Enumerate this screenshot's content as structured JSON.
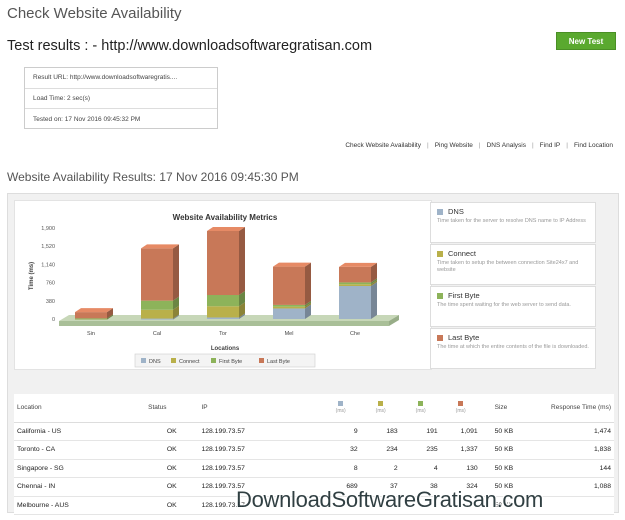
{
  "page": {
    "title": "Check Website Availability"
  },
  "test": {
    "header": "Test results : - http://www.downloadsoftwaregratisan.com",
    "new_test_label": "New Test",
    "result_url": "Result URL: http://www.downloadsoftwaregratis....",
    "load_time": "Load Time: 2 sec(s)",
    "tested_on": "Tested on: 17 Nov 2016 09:45:32 PM"
  },
  "tools": [
    "Check Website Availability",
    "Ping Website",
    "DNS Analysis",
    "Find IP",
    "Find Location"
  ],
  "results_title": "Website Availability Results: 17 Nov 2016 09:45:30 PM",
  "colors": {
    "dns": "#9fb3c8",
    "connect": "#b9b04a",
    "first_byte": "#8db35a",
    "last_byte": "#c87858",
    "accent": "#5aa92f"
  },
  "chart_data": {
    "type": "bar",
    "stacked": true,
    "title": "Website Availability Metrics",
    "xlabel": "Locations",
    "ylabel": "Time (ms)",
    "ylim": [
      0,
      1900
    ],
    "yticks": [
      "0",
      "380",
      "760",
      "1,140",
      "1,520",
      "1,900"
    ],
    "ytick_values": [
      0,
      380,
      760,
      1140,
      1520,
      1900
    ],
    "categories": [
      "Sin",
      "Cal",
      "Tor",
      "Mel",
      "Che"
    ],
    "series": [
      {
        "name": "DNS",
        "values": [
          8,
          9,
          32,
          220,
          689
        ]
      },
      {
        "name": "Connect",
        "values": [
          2,
          183,
          234,
          37,
          37
        ]
      },
      {
        "name": "First Byte",
        "values": [
          4,
          191,
          235,
          37,
          38
        ]
      },
      {
        "name": "Last Byte",
        "values": [
          130,
          1091,
          1337,
          800,
          324
        ]
      }
    ],
    "legend_position": "bottom",
    "grid": false
  },
  "metrics_legend": [
    {
      "title": "DNS",
      "desc": "Time taken for the server to resolve DNS name to IP Address"
    },
    {
      "title": "Connect",
      "desc": "Time taken to setup the between connection Site24x7 and website"
    },
    {
      "title": "First Byte",
      "desc": "The time spent waiting for the web server to send data."
    },
    {
      "title": "Last Byte",
      "desc": "The time at which the entire contents of the file is downloaded."
    }
  ],
  "table": {
    "headers": {
      "location": "Location",
      "status": "Status",
      "ip": "IP",
      "ms": "(ms)",
      "size": "Size",
      "response": "Response Time (ms)"
    },
    "rows": [
      {
        "location": "California - US",
        "status": "OK",
        "ip": "128.199.73.57",
        "dns": "9",
        "connect": "183",
        "first": "191",
        "last": "1,091",
        "size": "50 KB",
        "resp": "1,474"
      },
      {
        "location": "Toronto - CA",
        "status": "OK",
        "ip": "128.199.73.57",
        "dns": "32",
        "connect": "234",
        "first": "235",
        "last": "1,337",
        "size": "50 KB",
        "resp": "1,838"
      },
      {
        "location": "Singapore - SG",
        "status": "OK",
        "ip": "128.199.73.57",
        "dns": "8",
        "connect": "2",
        "first": "4",
        "last": "130",
        "size": "50 KB",
        "resp": "144"
      },
      {
        "location": "Chennai - IN",
        "status": "OK",
        "ip": "128.199.73.57",
        "dns": "689",
        "connect": "37",
        "first": "38",
        "last": "324",
        "size": "50 KB",
        "resp": "1,088"
      },
      {
        "location": "Melbourne - AUS",
        "status": "OK",
        "ip": "128.199.73.57",
        "dns": "",
        "connect": "",
        "first": "",
        "last": "",
        "size": "50 KB",
        "resp": ""
      }
    ]
  },
  "watermark": "DownloadSoftwareGratisan.com"
}
